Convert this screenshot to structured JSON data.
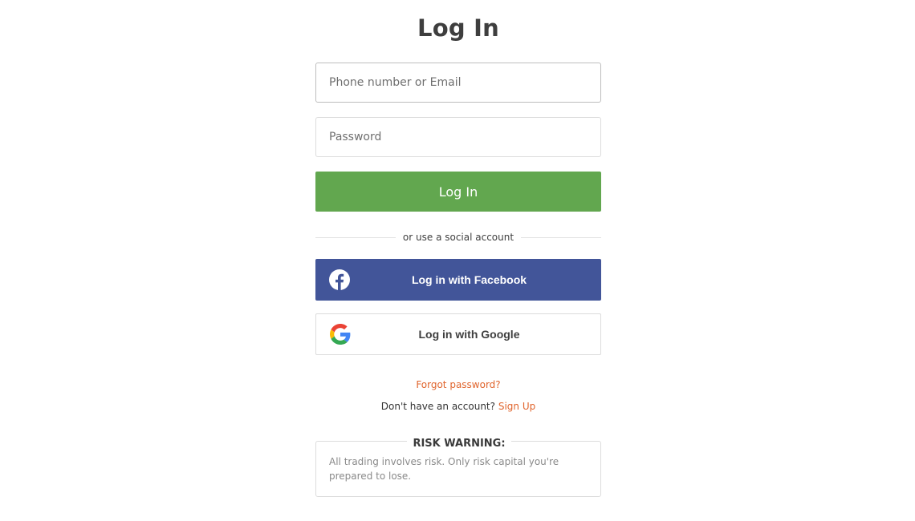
{
  "title": "Log In",
  "form": {
    "phone_placeholder": "Phone number or Email",
    "password_placeholder": "Password",
    "login_label": "Log In"
  },
  "divider_text": "or use a social account",
  "social": {
    "facebook_label": "Log in with Facebook",
    "google_label": "Log in with Google"
  },
  "links": {
    "forgot": "Forgot password?",
    "no_account": "Don't have an account?",
    "signup": "Sign Up"
  },
  "risk": {
    "heading": "RISK WARNING:",
    "text": "All trading involves risk. Only risk capital you're prepared to lose."
  },
  "colors": {
    "login_button": "#62a74f",
    "facebook": "#425599",
    "link_orange": "#e0642c"
  },
  "icons": {
    "facebook": "facebook-icon",
    "google": "google-icon"
  }
}
